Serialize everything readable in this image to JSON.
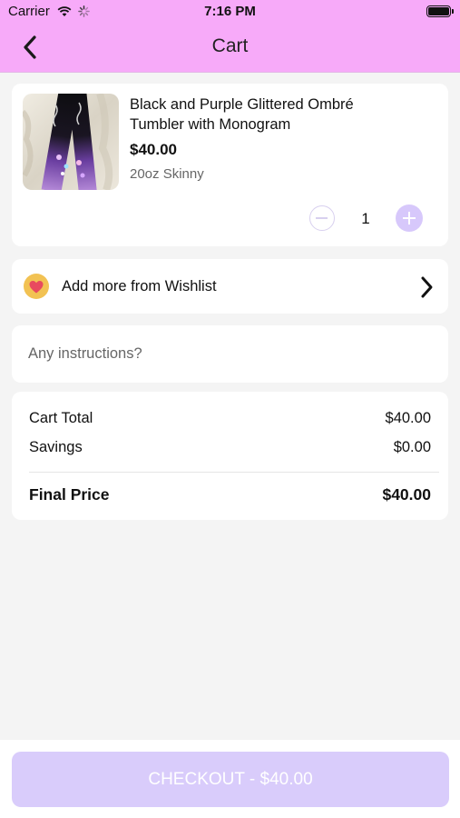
{
  "status_bar": {
    "carrier": "Carrier",
    "time": "7:16 PM"
  },
  "nav": {
    "title": "Cart",
    "back_icon": "chevron-left-icon"
  },
  "cart": {
    "items": [
      {
        "name": "Black and Purple Glittered Ombré Tumbler with Monogram",
        "price": "$40.00",
        "variant": "20oz Skinny",
        "quantity": "1"
      }
    ]
  },
  "wishlist": {
    "label": "Add more from Wishlist",
    "icon": "heart-icon"
  },
  "instructions": {
    "placeholder": "Any instructions?",
    "value": ""
  },
  "summary": {
    "cart_total_label": "Cart Total",
    "cart_total_value": "$40.00",
    "savings_label": "Savings",
    "savings_value": "$0.00",
    "final_label": "Final Price",
    "final_value": "$40.00"
  },
  "checkout": {
    "label": "CHECKOUT - $40.00"
  },
  "colors": {
    "header_bg": "#f7aaf9",
    "accent_light": "#d7c8fb",
    "heart_badge": "#f2c253",
    "heart": "#e84a5f",
    "page_bg": "#f4f4f4"
  }
}
